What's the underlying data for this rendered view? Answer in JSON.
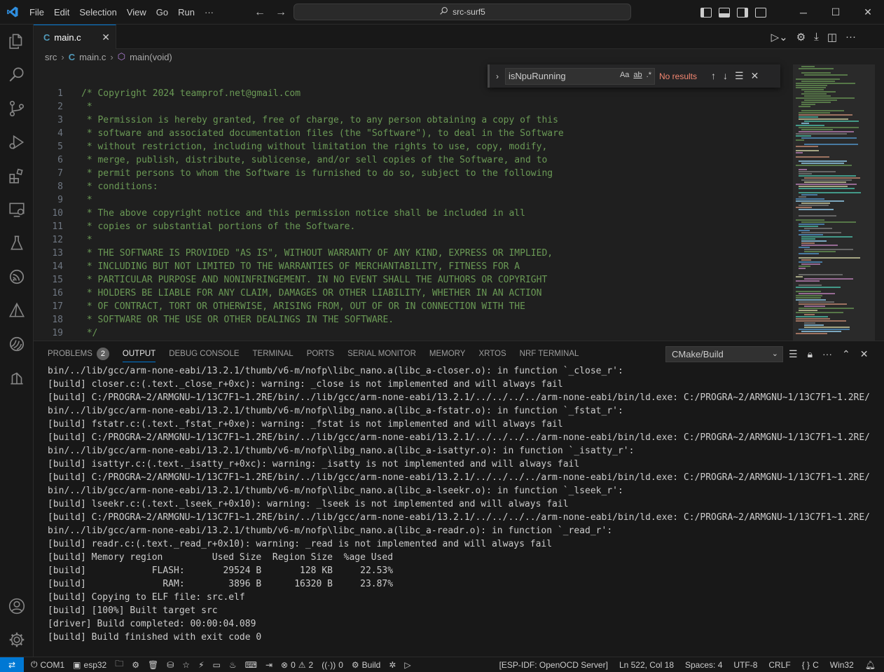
{
  "titlebar": {
    "menu": [
      "File",
      "Edit",
      "Selection",
      "View",
      "Go",
      "Run",
      "···"
    ],
    "command_center": "src-surf5"
  },
  "tab": {
    "filename": "main.c",
    "icon": "C"
  },
  "breadcrumb": {
    "folder": "src",
    "file": "main.c",
    "symbol": "main(void)",
    "file_icon": "C"
  },
  "find": {
    "query": "isNpuRunning",
    "match_case": "Aa",
    "whole_word": "ab",
    "regex": ".*",
    "result": "No results"
  },
  "code": {
    "line_numbers": [
      "1",
      "2",
      "3",
      "4",
      "5",
      "6",
      "7",
      "8",
      "9",
      "10",
      "11",
      "12",
      "13",
      "14",
      "15",
      "16",
      "17",
      "18",
      "19"
    ],
    "lines": [
      "/* Copyright 2024 teamprof.net@gmail.com",
      " *",
      " * Permission is hereby granted, free of charge, to any person obtaining a copy of this",
      " * software and associated documentation files (the \"Software\"), to deal in the Software",
      " * without restriction, including without limitation the rights to use, copy, modify,",
      " * merge, publish, distribute, sublicense, and/or sell copies of the Software, and to",
      " * permit persons to whom the Software is furnished to do so, subject to the following",
      " * conditions:",
      " *",
      " * The above copyright notice and this permission notice shall be included in all",
      " * copies or substantial portions of the Software.",
      " *",
      " * THE SOFTWARE IS PROVIDED \"AS IS\", WITHOUT WARRANTY OF ANY KIND, EXPRESS OR IMPLIED,",
      " * INCLUDING BUT NOT LIMITED TO THE WARRANTIES OF MERCHANTABILITY, FITNESS FOR A",
      " * PARTICULAR PURPOSE AND NONINFRINGEMENT. IN NO EVENT SHALL THE AUTHORS OR COPYRIGHT",
      " * HOLDERS BE LIABLE FOR ANY CLAIM, DAMAGES OR OTHER LIABILITY, WHETHER IN AN ACTION",
      " * OF CONTRACT, TORT OR OTHERWISE, ARISING FROM, OUT OF OR IN CONNECTION WITH THE",
      " * SOFTWARE OR THE USE OR OTHER DEALINGS IN THE SOFTWARE.",
      " */"
    ]
  },
  "panel": {
    "tabs": [
      "PROBLEMS",
      "OUTPUT",
      "DEBUG CONSOLE",
      "TERMINAL",
      "PORTS",
      "SERIAL MONITOR",
      "MEMORY",
      "XRTOS",
      "NRF TERMINAL"
    ],
    "problems_count": "2",
    "active_tab": "OUTPUT",
    "output_channel": "CMake/Build",
    "output_lines": [
      "bin/../lib/gcc/arm-none-eabi/13.2.1/thumb/v6-m/nofp\\libc_nano.a(libc_a-closer.o): in function `_close_r':",
      "[build] closer.c:(.text._close_r+0xc): warning: _close is not implemented and will always fail",
      "[build] C:/PROGRA~2/ARMGNU~1/13C7F1~1.2RE/bin/../lib/gcc/arm-none-eabi/13.2.1/../../../../arm-none-eabi/bin/ld.exe: C:/PROGRA~2/ARMGNU~1/13C7F1~1.2RE/",
      "bin/../lib/gcc/arm-none-eabi/13.2.1/thumb/v6-m/nofp\\libg_nano.a(libc_a-fstatr.o): in function `_fstat_r':",
      "[build] fstatr.c:(.text._fstat_r+0xe): warning: _fstat is not implemented and will always fail",
      "[build] C:/PROGRA~2/ARMGNU~1/13C7F1~1.2RE/bin/../lib/gcc/arm-none-eabi/13.2.1/../../../../arm-none-eabi/bin/ld.exe: C:/PROGRA~2/ARMGNU~1/13C7F1~1.2RE/",
      "bin/../lib/gcc/arm-none-eabi/13.2.1/thumb/v6-m/nofp\\libg_nano.a(libc_a-isattyr.o): in function `_isatty_r':",
      "[build] isattyr.c:(.text._isatty_r+0xc): warning: _isatty is not implemented and will always fail",
      "[build] C:/PROGRA~2/ARMGNU~1/13C7F1~1.2RE/bin/../lib/gcc/arm-none-eabi/13.2.1/../../../../arm-none-eabi/bin/ld.exe: C:/PROGRA~2/ARMGNU~1/13C7F1~1.2RE/",
      "bin/../lib/gcc/arm-none-eabi/13.2.1/thumb/v6-m/nofp\\libc_nano.a(libc_a-lseekr.o): in function `_lseek_r':",
      "[build] lseekr.c:(.text._lseek_r+0x10): warning: _lseek is not implemented and will always fail",
      "[build] C:/PROGRA~2/ARMGNU~1/13C7F1~1.2RE/bin/../lib/gcc/arm-none-eabi/13.2.1/../../../../arm-none-eabi/bin/ld.exe: C:/PROGRA~2/ARMGNU~1/13C7F1~1.2RE/",
      "bin/../lib/gcc/arm-none-eabi/13.2.1/thumb/v6-m/nofp\\libc_nano.a(libc_a-readr.o): in function `_read_r':",
      "[build] readr.c:(.text._read_r+0x10): warning: _read is not implemented and will always fail",
      "[build] Memory region         Used Size  Region Size  %age Used",
      "[build]            FLASH:       29524 B       128 KB     22.53%",
      "[build]              RAM:        3896 B      16320 B     23.87%",
      "[build] Copying to ELF file: src.elf",
      "[build] [100%] Built target src",
      "[driver] Build completed: 00:00:04.089",
      "[build] Build finished with exit code 0"
    ]
  },
  "statusbar": {
    "port": "COM1",
    "target": "esp32",
    "errors": "0",
    "warnings": "2",
    "ports_count": "0",
    "build": "Build",
    "openocd": "[ESP-IDF: OpenOCD Server]",
    "cursor": "Ln 522, Col 18",
    "indent": "Spaces: 4",
    "encoding": "UTF-8",
    "eol": "CRLF",
    "language": "C",
    "platform": "Win32"
  },
  "colors": {
    "accent": "#0078d4",
    "comment": "#6a9955",
    "no_results": "#f48771"
  }
}
